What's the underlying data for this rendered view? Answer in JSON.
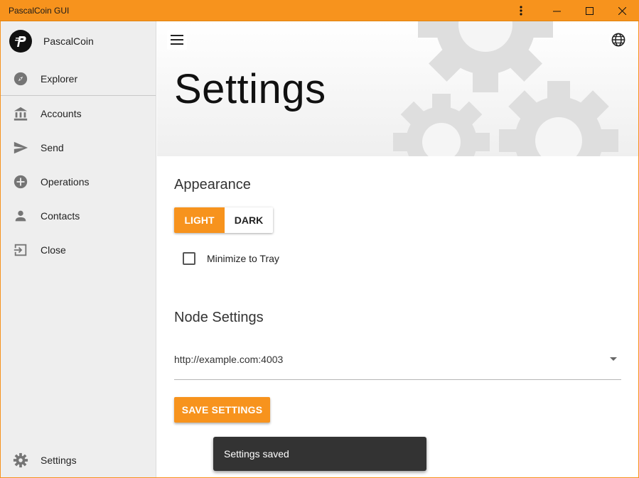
{
  "window": {
    "title": "PascalCoin GUI",
    "accent_color": "#f7931d",
    "controls": [
      "more-vert-icon",
      "minimize-icon",
      "maximize-icon",
      "close-icon"
    ]
  },
  "sidebar": {
    "brand": {
      "name": "PascalCoin",
      "icon": "pascalcoin-logo-icon"
    },
    "items": [
      {
        "label": "Explorer",
        "icon": "compass-icon"
      },
      {
        "label": "Accounts",
        "icon": "bank-icon"
      },
      {
        "label": "Send",
        "icon": "send-icon"
      },
      {
        "label": "Operations",
        "icon": "add-circle-icon"
      },
      {
        "label": "Contacts",
        "icon": "person-icon"
      },
      {
        "label": "Close",
        "icon": "exit-icon"
      }
    ],
    "footer_item": {
      "label": "Settings",
      "icon": "gear-icon"
    }
  },
  "header": {
    "title": "Settings",
    "menu_icon": "hamburger-menu-icon",
    "language_icon": "globe-icon",
    "background_icon": "gears-icon"
  },
  "appearance": {
    "title": "Appearance",
    "theme_options": [
      "LIGHT",
      "DARK"
    ],
    "selected_theme": "LIGHT",
    "minimize_to_tray": {
      "label": "Minimize to Tray",
      "checked": false
    }
  },
  "node_settings": {
    "title": "Node Settings",
    "node_url": "http://example.com:4003",
    "save_label": "SAVE SETTINGS"
  },
  "snackbar": {
    "message": "Settings saved"
  }
}
